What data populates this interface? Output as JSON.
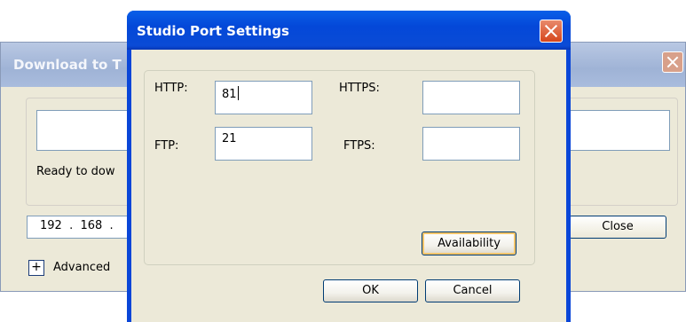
{
  "background_window": {
    "title": "Download to T",
    "status_text": "Ready to dow",
    "ip_value": "192  .  168  .",
    "close_label": "Close",
    "expand_label": "+",
    "advanced_label": "Advanced"
  },
  "dialog": {
    "title": "Studio Port Settings",
    "http_label": "HTTP:",
    "http_value": "81",
    "https_label": "HTTPS:",
    "https_value": "",
    "ftp_label": "FTP:",
    "ftp_value": "21",
    "ftps_label": "FTPS:",
    "ftps_value": "",
    "availability_label": "Availability",
    "ok_label": "OK",
    "cancel_label": "Cancel"
  },
  "colors": {
    "titlebar_active": "#0a4bd6",
    "close_button": "#d6461c",
    "dialog_face": "#ece9d8",
    "input_border": "#7f9db9"
  }
}
